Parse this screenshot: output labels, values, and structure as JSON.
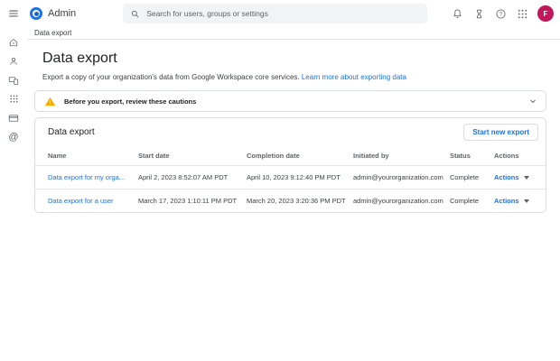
{
  "topbar": {
    "brand": "Admin",
    "search_placeholder": "Search for users, groups or settings",
    "avatar_letter": "F"
  },
  "sidebar": {
    "items": [
      {
        "icon": "home-icon"
      },
      {
        "icon": "directory-person-icon"
      },
      {
        "icon": "devices-icon"
      },
      {
        "icon": "apps-grid-icon"
      },
      {
        "icon": "billing-card-icon"
      },
      {
        "icon": "account-at-icon"
      }
    ]
  },
  "breadcrumb": "Data export",
  "page": {
    "title": "Data export",
    "subtitle": "Export a copy of your organization's data from Google Workspace core services. ",
    "subtitle_link": "Learn more about exporting data"
  },
  "banner": {
    "text": "Before you export, review these cautions"
  },
  "card": {
    "title": "Data export",
    "start_button": "Start new export"
  },
  "table": {
    "headers": [
      "Name",
      "Start date",
      "Completion date",
      "Initiated by",
      "Status",
      "Actions"
    ],
    "rows": [
      {
        "name": "Data export for my orga...",
        "start": "April 2, 2023 8:52:07 AM PDT",
        "completion": "April 10, 2023 9:12:40 PM PDT",
        "initiated_by": "admin@yourorganization.com",
        "status": "Complete",
        "actions": "Actions"
      },
      {
        "name": "Data export for a user",
        "start": "March 17, 2023 1:10:11 PM PDT",
        "completion": "March 20, 2023 3:20:36 PM PDT",
        "initiated_by": "admin@yourorganization.com",
        "status": "Complete",
        "actions": "Actions"
      }
    ]
  },
  "colors": {
    "accent_blue": "#1a73e8",
    "warning_amber": "#f9ab00",
    "avatar_pink": "#c2185b",
    "search_bg": "#f1f3f4",
    "border": "#dadce0"
  }
}
